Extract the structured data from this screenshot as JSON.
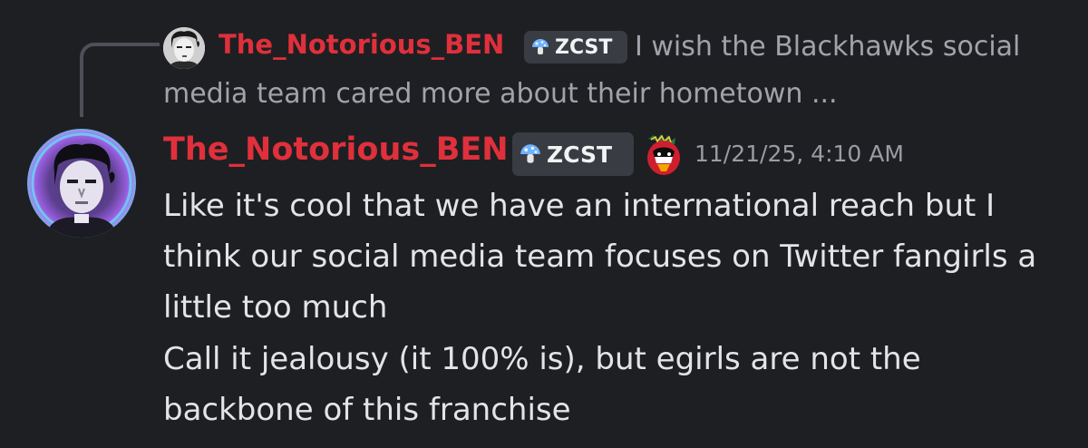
{
  "reply": {
    "username": "The_Notorious_BEN",
    "tag": "ZCST",
    "text": "I wish the Blackhawks social media team cared more about their hometown ..."
  },
  "message": {
    "username": "The_Notorious_BEN",
    "tag": "ZCST",
    "timestamp": "11/21/25, 4:10 AM",
    "lines": [
      "Like it's cool that we have an international reach but I think our social media team focuses on Twitter fangirls a little too much",
      "Call it jealousy (it 100% is), but egirls are not the backbone of this franchise"
    ]
  },
  "colors": {
    "background": "#1e1f23",
    "username": "#e0303b",
    "tag_bg": "#3a3c43",
    "reply_text": "#a0a3aa",
    "body_text": "#e3e4e7",
    "timestamp": "#9a9ca3"
  },
  "icons": {
    "tag_icon": "mushroom-icon",
    "team_logo": "blackhawks-logo-icon"
  }
}
